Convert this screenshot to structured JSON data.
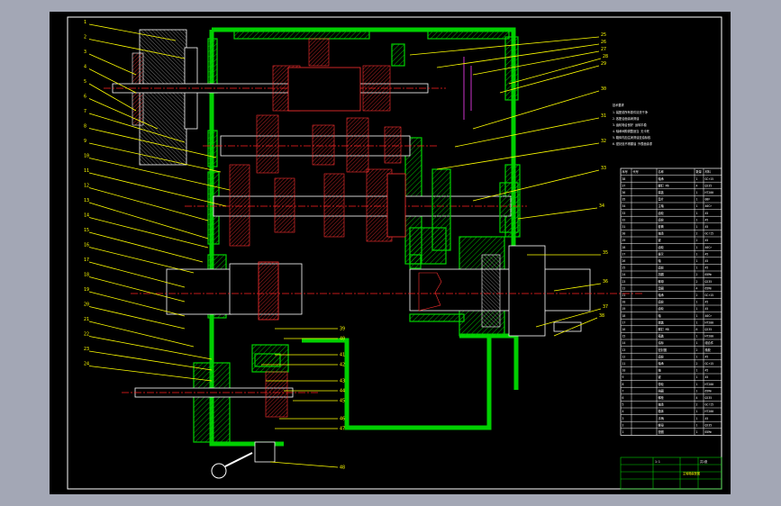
{
  "colors": {
    "background": "#a3a7b5",
    "sheet": "#000000",
    "leader": "#ffff00",
    "housing": "#00d000",
    "gear_outline": "#ff3030",
    "center_line": "#ff2020",
    "outline": "#ffffff"
  },
  "callouts": {
    "left": [
      "1",
      "2",
      "3",
      "4",
      "5",
      "6",
      "7",
      "8",
      "9",
      "10",
      "11",
      "12",
      "13",
      "14",
      "15",
      "16",
      "17",
      "18",
      "19",
      "20",
      "21",
      "22",
      "23",
      "24"
    ],
    "right": [
      "25",
      "26",
      "27",
      "28",
      "29",
      "30",
      "31",
      "32",
      "33",
      "34",
      "35",
      "36",
      "37",
      "38"
    ],
    "bottom": [
      "39",
      "40",
      "41",
      "42",
      "43",
      "44",
      "45",
      "46",
      "47",
      "48"
    ]
  },
  "notes": {
    "heading": "技术要求",
    "lines": [
      "1.装配前所有零件清洗干净",
      "2.各配合面涂润滑油",
      "3.齿轮啮合良好 运转平稳",
      "4.轴承间隙调整适当 无卡死",
      "5.箱体内加注润滑油至油标线",
      "6.密封处不得漏油 外表面涂漆"
    ]
  },
  "parts_table": {
    "header": [
      "序号",
      "代号",
      "名称",
      "数量",
      "材料"
    ],
    "rows": [
      [
        "38",
        "",
        "轴承",
        "1",
        "GCr15"
      ],
      [
        "37",
        "",
        "螺钉 M6",
        "4",
        "Q235"
      ],
      [
        "36",
        "",
        "端盖",
        "1",
        "HT200"
      ],
      [
        "35",
        "",
        "垫片",
        "1",
        "08F"
      ],
      [
        "34",
        "",
        "主轴",
        "1",
        "40Cr"
      ],
      [
        "33",
        "",
        "齿轮",
        "1",
        "45"
      ],
      [
        "32",
        "",
        "齿轮",
        "1",
        "45"
      ],
      [
        "31",
        "",
        "套筒",
        "1",
        "45"
      ],
      [
        "30",
        "",
        "轴承",
        "2",
        "GCr15"
      ],
      [
        "29",
        "",
        "键",
        "2",
        "45"
      ],
      [
        "28",
        "",
        "齿轮",
        "1",
        "40Cr"
      ],
      [
        "27",
        "",
        "拨叉",
        "1",
        "45"
      ],
      [
        "26",
        "",
        "轴",
        "1",
        "45"
      ],
      [
        "25",
        "",
        "齿轮",
        "1",
        "45"
      ],
      [
        "24",
        "",
        "挡圈",
        "2",
        "65Mn"
      ],
      [
        "23",
        "",
        "螺母",
        "2",
        "Q235"
      ],
      [
        "22",
        "",
        "垫圈",
        "4",
        "65Mn"
      ],
      [
        "21",
        "",
        "轴承",
        "2",
        "GCr15"
      ],
      [
        "20",
        "",
        "齿轮",
        "1",
        "45"
      ],
      [
        "19",
        "",
        "齿轮",
        "1",
        "45"
      ],
      [
        "18",
        "",
        "轴",
        "1",
        "40Cr"
      ],
      [
        "17",
        "",
        "端盖",
        "1",
        "HT200"
      ],
      [
        "16",
        "",
        "螺钉 M8",
        "6",
        "Q235"
      ],
      [
        "15",
        "",
        "箱盖",
        "1",
        "HT200"
      ],
      [
        "14",
        "",
        "油标",
        "1",
        "组合件"
      ],
      [
        "13",
        "",
        "密封圈",
        "2",
        "橡胶"
      ],
      [
        "12",
        "",
        "齿轮",
        "1",
        "45"
      ],
      [
        "11",
        "",
        "轴承",
        "2",
        "GCr15"
      ],
      [
        "10",
        "",
        "轴",
        "1",
        "45"
      ],
      [
        "9",
        "",
        "键",
        "1",
        "45"
      ],
      [
        "8",
        "",
        "带轮",
        "1",
        "HT200"
      ],
      [
        "7",
        "",
        "挡圈",
        "1",
        "65Mn"
      ],
      [
        "6",
        "",
        "螺栓",
        "4",
        "Q235"
      ],
      [
        "5",
        "",
        "轴承",
        "2",
        "GCr15"
      ],
      [
        "4",
        "",
        "箱体",
        "1",
        "HT200"
      ],
      [
        "3",
        "",
        "手柄",
        "1",
        "45"
      ],
      [
        "2",
        "",
        "螺母",
        "1",
        "Q235"
      ],
      [
        "1",
        "",
        "垫圈",
        "1",
        "65Mn"
      ]
    ]
  },
  "title_block": {
    "name": "主轴箱装配图",
    "scale": "1:1",
    "sheet": "共1张"
  }
}
